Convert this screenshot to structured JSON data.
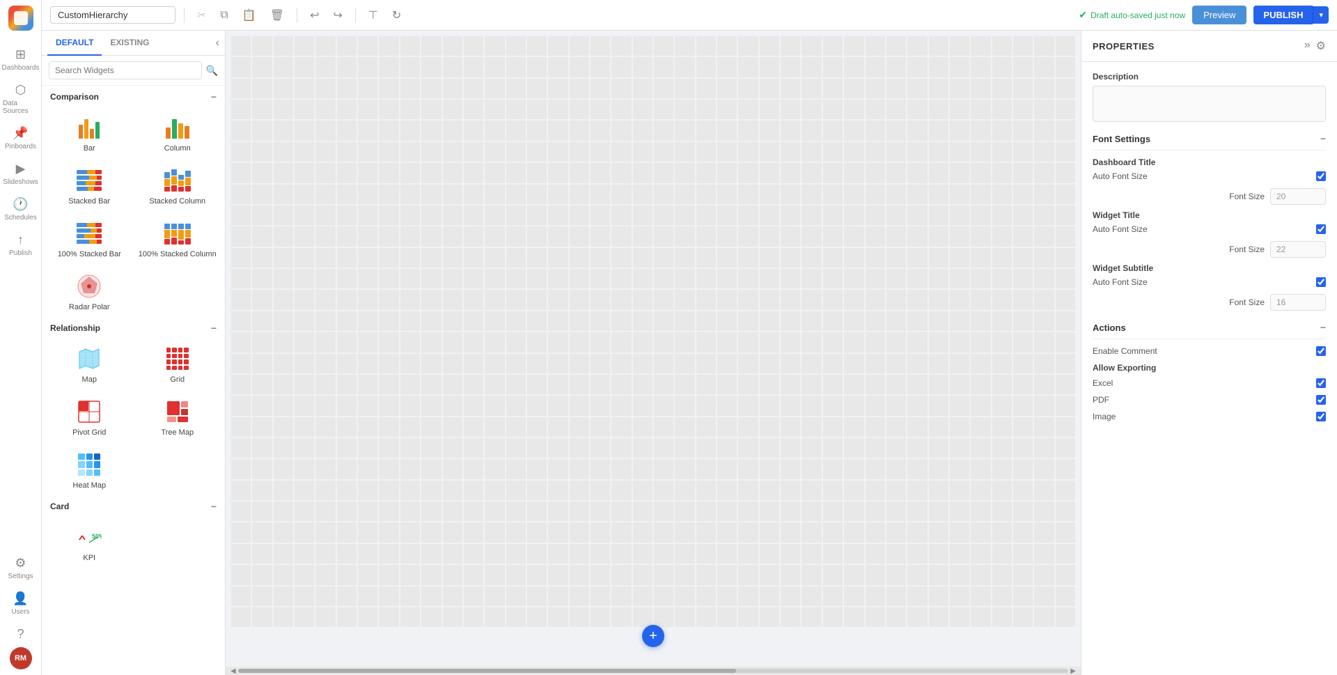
{
  "toolbar": {
    "input_value": "CustomHierarchy",
    "input_placeholder": "CustomHierarchy",
    "auto_save_message": "Draft auto-saved just now",
    "preview_label": "Preview",
    "publish_label": "PUBLISH"
  },
  "widget_panel": {
    "tab_default": "DEFAULT",
    "tab_existing": "EXISTING",
    "search_placeholder": "Search Widgets",
    "sections": [
      {
        "name": "Comparison",
        "widgets": [
          {
            "id": "bar",
            "label": "Bar"
          },
          {
            "id": "column",
            "label": "Column"
          },
          {
            "id": "stacked-bar",
            "label": "Stacked Bar"
          },
          {
            "id": "stacked-column",
            "label": "Stacked Column"
          },
          {
            "id": "100-stacked-bar",
            "label": "100% Stacked Bar"
          },
          {
            "id": "100-stacked-column",
            "label": "100% Stacked Column"
          },
          {
            "id": "radar-polar",
            "label": "Radar Polar"
          }
        ]
      },
      {
        "name": "Relationship",
        "widgets": [
          {
            "id": "map",
            "label": "Map"
          },
          {
            "id": "grid",
            "label": "Grid"
          },
          {
            "id": "pivot-grid",
            "label": "Pivot Grid"
          },
          {
            "id": "tree-map",
            "label": "Tree Map"
          },
          {
            "id": "heat-map",
            "label": "Heat Map"
          }
        ]
      },
      {
        "name": "Card",
        "widgets": []
      }
    ]
  },
  "properties": {
    "title": "PROPERTIES",
    "description_label": "Description",
    "description_placeholder": "",
    "font_settings_label": "Font Settings",
    "dashboard_title_label": "Dashboard Title",
    "auto_font_size_label": "Auto Font Size",
    "font_size_label": "Font Size",
    "dashboard_font_size_value": "20",
    "widget_title_label": "Widget Title",
    "widget_title_font_size": "22",
    "widget_subtitle_label": "Widget Subtitle",
    "widget_subtitle_font_size": "16",
    "actions_label": "Actions",
    "enable_comment_label": "Enable Comment",
    "allow_exporting_label": "Allow Exporting",
    "excel_label": "Excel",
    "pdf_label": "PDF",
    "image_label": "Image"
  },
  "nav": {
    "dashboards_label": "Dashboards",
    "data_sources_label": "Data Sources",
    "pinboards_label": "Pinboards",
    "slideshows_label": "Slideshows",
    "schedules_label": "Schedules",
    "publish_nav_label": "Publish",
    "settings_label": "Settings",
    "users_label": "Users",
    "help_label": "Help",
    "avatar_initials": "RM"
  }
}
